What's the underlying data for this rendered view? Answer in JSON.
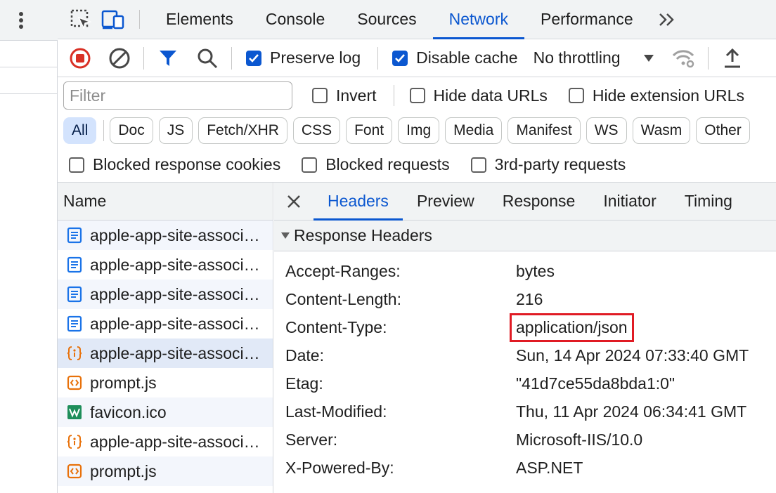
{
  "main_tabs": [
    {
      "label": "Elements",
      "active": false
    },
    {
      "label": "Console",
      "active": false
    },
    {
      "label": "Sources",
      "active": false
    },
    {
      "label": "Network",
      "active": true
    },
    {
      "label": "Performance",
      "active": false
    }
  ],
  "toolbar": {
    "preserve_log_label": "Preserve log",
    "disable_cache_label": "Disable cache",
    "throttling_value": "No throttling"
  },
  "filter": {
    "placeholder": "Filter",
    "invert_label": "Invert",
    "hide_data_urls_label": "Hide data URLs",
    "hide_extension_urls_label": "Hide extension URLs"
  },
  "types": [
    "All",
    "Doc",
    "JS",
    "Fetch/XHR",
    "CSS",
    "Font",
    "Img",
    "Media",
    "Manifest",
    "WS",
    "Wasm",
    "Other"
  ],
  "blocked": {
    "cookies_label": "Blocked response cookies",
    "requests_label": "Blocked requests",
    "third_party_label": "3rd-party requests"
  },
  "requests": {
    "header": "Name",
    "rows": [
      {
        "name": "apple-app-site-association",
        "icon": "document-icon"
      },
      {
        "name": "apple-app-site-association",
        "icon": "document-icon"
      },
      {
        "name": "apple-app-site-association",
        "icon": "document-icon"
      },
      {
        "name": "apple-app-site-association",
        "icon": "document-icon"
      },
      {
        "name": "apple-app-site-association",
        "icon": "fetch-icon"
      },
      {
        "name": "prompt.js",
        "icon": "script-icon"
      },
      {
        "name": "favicon.ico",
        "icon": "image-icon"
      },
      {
        "name": "apple-app-site-association",
        "icon": "fetch-icon"
      },
      {
        "name": "prompt.js",
        "icon": "script-icon"
      }
    ]
  },
  "detail": {
    "tabs": [
      "Headers",
      "Preview",
      "Response",
      "Initiator",
      "Timing"
    ],
    "section_title": "Response Headers",
    "headers": [
      {
        "key": "Accept-Ranges:",
        "value": "bytes"
      },
      {
        "key": "Content-Length:",
        "value": "216"
      },
      {
        "key": "Content-Type:",
        "value": "application/json"
      },
      {
        "key": "Date:",
        "value": "Sun, 14 Apr 2024 07:33:40 GMT"
      },
      {
        "key": "Etag:",
        "value": "\"41d7ce55da8bda1:0\""
      },
      {
        "key": "Last-Modified:",
        "value": "Thu, 11 Apr 2024 06:34:41 GMT"
      },
      {
        "key": "Server:",
        "value": "Microsoft-IIS/10.0"
      },
      {
        "key": "X-Powered-By:",
        "value": "ASP.NET"
      }
    ]
  },
  "colors": {
    "accent": "#0b57d0",
    "highlight_box": "#e01b24",
    "record": "#d93025"
  }
}
